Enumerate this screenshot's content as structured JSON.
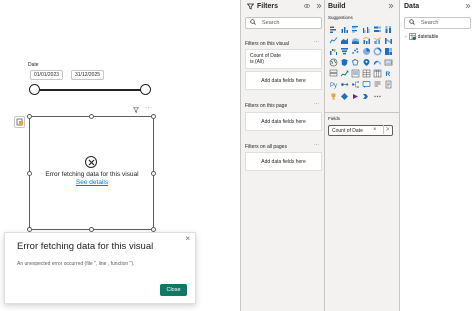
{
  "canvas": {
    "date_label": "Date",
    "date_start": "01/01/2023",
    "date_end": "31/12/2025",
    "visual_error_text": "Error fetching data for this visual ",
    "visual_error_link": "See details",
    "filter_icon": "filter-icon",
    "more_icon": "more-options-icon",
    "more_glyph": "···"
  },
  "dialog": {
    "title": "Error fetching data for this visual",
    "message": "An unexpected error occurred (file '', line , function '').",
    "close_button": "Close",
    "close_icon": "×"
  },
  "filters": {
    "title": "Filters",
    "search_placeholder": "Search",
    "on_visual_label": "Filters on this visual",
    "card_title": "Count of Date",
    "card_value": "is (All)",
    "add_fields": "Add data fields here",
    "on_page_label": "Filters on this page",
    "on_all_label": "Filters on all pages",
    "more_glyph": "···"
  },
  "build": {
    "title": "Build",
    "suggestions_label": "Suggestions",
    "fields_label": "Fields",
    "field_chip": "Count of Date",
    "chip_remove": "×",
    "chip_chevron": ">"
  },
  "data_pane": {
    "title": "Data",
    "search_placeholder": "Search",
    "table_name": "datetable"
  },
  "colors": {
    "accent": "#117865",
    "link": "#0078d4",
    "pane_bg": "#f3f2f1",
    "viz_blue": "#1f6fbf"
  }
}
